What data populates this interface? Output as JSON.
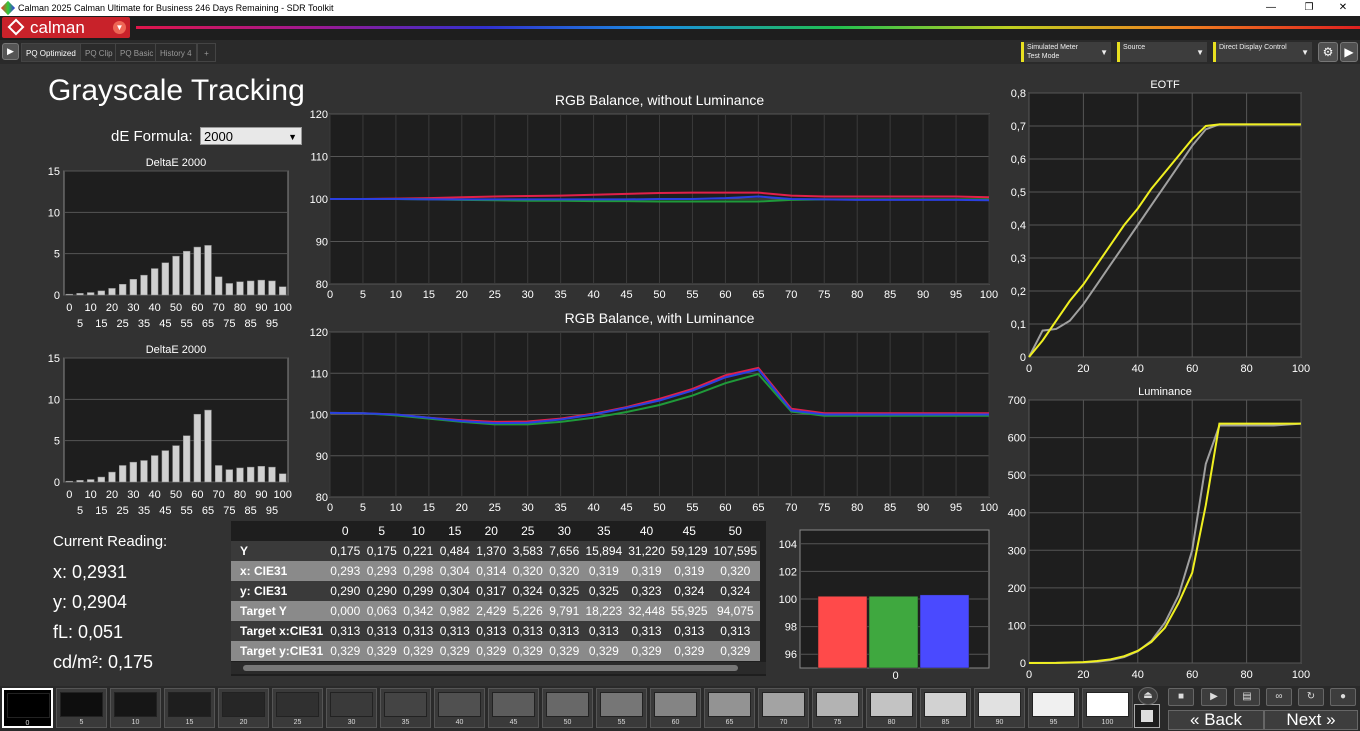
{
  "window": {
    "title": "Calman 2025 Calman Ultimate for Business 246 Days Remaining  - SDR Toolkit",
    "min": "—",
    "max": "❐",
    "close": "✕"
  },
  "brand": {
    "logo": "calman"
  },
  "tabs": [
    {
      "label": "PQ Optimized",
      "active": true
    },
    {
      "label": "PQ Clip"
    },
    {
      "label": "PQ Basic"
    },
    {
      "label": "History 4"
    },
    {
      "label": "+"
    }
  ],
  "controls": {
    "meter": {
      "line1": "Simulated Meter",
      "line2": "Test Mode"
    },
    "source": {
      "line1": "Source",
      "line2": ""
    },
    "display": {
      "line1": "Direct Display Control",
      "line2": ""
    }
  },
  "page": {
    "title": "Grayscale Tracking",
    "de_label": "dE Formula:",
    "de_value": "2000"
  },
  "colors": {
    "red": "#e0204a",
    "green": "#1f9a3a",
    "blue": "#2a3fe0",
    "yellow": "#f0f020",
    "gray_curve": "#a0a0a0"
  },
  "chart_data": [
    {
      "id": "de1",
      "type": "bar",
      "title": "DeltaE 2000",
      "ylim": [
        0,
        15
      ],
      "yticks": [
        0,
        5,
        10,
        15
      ],
      "x": [
        0,
        5,
        10,
        15,
        20,
        25,
        30,
        35,
        40,
        45,
        50,
        55,
        60,
        65,
        70,
        75,
        80,
        85,
        90,
        95,
        100
      ],
      "values": [
        0.1,
        0.2,
        0.3,
        0.5,
        0.8,
        1.3,
        1.9,
        2.4,
        3.2,
        3.9,
        4.7,
        5.3,
        5.8,
        6.0,
        2.2,
        1.4,
        1.6,
        1.7,
        1.8,
        1.7,
        1.0
      ],
      "xlabels_top": [
        "0",
        "10",
        "20",
        "30",
        "40",
        "50",
        "60",
        "70",
        "80",
        "90",
        "100"
      ],
      "xlabels_bottom": [
        "5",
        "15",
        "25",
        "35",
        "45",
        "55",
        "65",
        "75",
        "85",
        "95"
      ]
    },
    {
      "id": "de2",
      "type": "bar",
      "title": "DeltaE 2000",
      "ylim": [
        0,
        15
      ],
      "yticks": [
        0,
        5,
        10,
        15
      ],
      "x": [
        0,
        5,
        10,
        15,
        20,
        25,
        30,
        35,
        40,
        45,
        50,
        55,
        60,
        65,
        70,
        75,
        80,
        85,
        90,
        95,
        100
      ],
      "values": [
        0.1,
        0.2,
        0.3,
        0.6,
        1.2,
        2.0,
        2.4,
        2.6,
        3.2,
        3.8,
        4.4,
        5.6,
        8.2,
        8.7,
        2.0,
        1.5,
        1.7,
        1.8,
        1.9,
        1.8,
        1.0
      ],
      "xlabels_top": [
        "0",
        "10",
        "20",
        "30",
        "40",
        "50",
        "60",
        "70",
        "80",
        "90",
        "100"
      ],
      "xlabels_bottom": [
        "5",
        "15",
        "25",
        "35",
        "45",
        "55",
        "65",
        "75",
        "85",
        "95"
      ]
    },
    {
      "id": "rgb1",
      "type": "line",
      "title": "RGB Balance, without Luminance",
      "ylim": [
        80,
        120
      ],
      "yticks": [
        80,
        90,
        100,
        110,
        120
      ],
      "x": [
        0,
        5,
        10,
        15,
        20,
        25,
        30,
        35,
        40,
        45,
        50,
        55,
        60,
        65,
        70,
        75,
        80,
        85,
        90,
        95,
        100
      ],
      "series": [
        {
          "color": "red",
          "values": [
            100.0,
            100.0,
            100.1,
            100.2,
            100.4,
            100.6,
            100.7,
            100.8,
            101.0,
            101.2,
            101.4,
            101.5,
            101.5,
            101.5,
            100.8,
            100.6,
            100.6,
            100.6,
            100.6,
            100.6,
            100.4
          ]
        },
        {
          "color": "green",
          "values": [
            100.0,
            100.0,
            100.0,
            99.9,
            99.8,
            99.7,
            99.6,
            99.6,
            99.5,
            99.5,
            99.4,
            99.4,
            99.4,
            99.4,
            99.8,
            99.9,
            99.9,
            99.9,
            99.9,
            99.9,
            99.9
          ]
        },
        {
          "color": "blue",
          "values": [
            100.0,
            100.0,
            100.0,
            99.9,
            99.9,
            99.9,
            99.9,
            99.9,
            99.9,
            99.9,
            100.0,
            100.0,
            100.2,
            100.6,
            100.0,
            99.9,
            99.8,
            99.8,
            99.8,
            99.8,
            99.7
          ]
        }
      ]
    },
    {
      "id": "rgb2",
      "type": "line",
      "title": "RGB Balance, with Luminance",
      "ylim": [
        80,
        120
      ],
      "yticks": [
        80,
        90,
        100,
        110,
        120
      ],
      "x": [
        0,
        5,
        10,
        15,
        20,
        25,
        30,
        35,
        40,
        45,
        50,
        55,
        60,
        65,
        70,
        75,
        80,
        85,
        90,
        95,
        100
      ],
      "series": [
        {
          "color": "red",
          "values": [
            100.4,
            100.3,
            100.0,
            99.2,
            98.6,
            98.2,
            98.3,
            99.0,
            100.2,
            101.8,
            103.8,
            106.2,
            109.5,
            111.3,
            101.4,
            100.3,
            100.3,
            100.3,
            100.3,
            100.3,
            100.3
          ]
        },
        {
          "color": "green",
          "values": [
            100.4,
            100.3,
            99.8,
            99.0,
            98.2,
            97.6,
            97.6,
            98.2,
            99.2,
            100.6,
            102.3,
            104.6,
            107.6,
            109.8,
            100.7,
            99.7,
            99.7,
            99.7,
            99.7,
            99.7,
            99.7
          ]
        },
        {
          "color": "blue",
          "values": [
            100.4,
            100.3,
            100.0,
            99.2,
            98.4,
            97.9,
            98.0,
            98.8,
            100.0,
            101.6,
            103.4,
            105.8,
            109.0,
            110.9,
            101.0,
            100.0,
            100.0,
            100.0,
            100.0,
            100.0,
            100.0
          ]
        }
      ]
    },
    {
      "id": "eotf",
      "type": "line",
      "title": "EOTF",
      "xlim": [
        0,
        100
      ],
      "ylim": [
        0,
        0.8
      ],
      "xticks": [
        0,
        20,
        40,
        60,
        80,
        100
      ],
      "ylabels": [
        "0",
        "0,1",
        "0,2",
        "0,3",
        "0,4",
        "0,5",
        "0,6",
        "0,7",
        "0,8"
      ],
      "series": [
        {
          "color": "gray",
          "x": [
            0,
            5,
            10,
            15,
            20,
            25,
            30,
            35,
            40,
            45,
            50,
            55,
            60,
            65,
            70,
            80,
            90,
            100
          ],
          "values": [
            0.0,
            0.08,
            0.085,
            0.11,
            0.16,
            0.22,
            0.28,
            0.34,
            0.4,
            0.46,
            0.52,
            0.58,
            0.64,
            0.69,
            0.705,
            0.705,
            0.705,
            0.705
          ]
        },
        {
          "color": "yellow",
          "x": [
            0,
            5,
            10,
            15,
            20,
            25,
            30,
            35,
            40,
            45,
            50,
            55,
            60,
            65,
            70,
            80,
            90,
            100
          ],
          "values": [
            0.0,
            0.05,
            0.11,
            0.17,
            0.22,
            0.28,
            0.34,
            0.4,
            0.45,
            0.51,
            0.56,
            0.61,
            0.66,
            0.7,
            0.705,
            0.705,
            0.705,
            0.705
          ]
        }
      ]
    },
    {
      "id": "lum",
      "type": "line",
      "title": "Luminance",
      "xlim": [
        0,
        100
      ],
      "ylim": [
        0,
        700
      ],
      "xticks": [
        0,
        20,
        40,
        60,
        80,
        100
      ],
      "yticks": [
        0,
        100,
        200,
        300,
        400,
        500,
        600,
        700
      ],
      "series": [
        {
          "color": "gray",
          "x": [
            0,
            10,
            20,
            25,
            30,
            35,
            40,
            45,
            50,
            55,
            60,
            65,
            70,
            80,
            90,
            100
          ],
          "values": [
            0.2,
            0.2,
            1.4,
            3.6,
            7.7,
            15.9,
            31.2,
            59.1,
            107.6,
            180,
            300,
            530,
            632,
            632,
            632,
            637
          ]
        },
        {
          "color": "yellow",
          "x": [
            0,
            10,
            20,
            25,
            30,
            35,
            40,
            45,
            50,
            55,
            60,
            65,
            70,
            80,
            90,
            100
          ],
          "values": [
            0.0,
            0.3,
            2.4,
            5.2,
            9.8,
            18.2,
            32.4,
            55.9,
            94.1,
            160,
            240,
            420,
            637,
            637,
            637,
            637
          ]
        }
      ]
    },
    {
      "id": "rgbbar",
      "type": "bar",
      "xlabel": "0",
      "ylim": [
        95,
        105
      ],
      "yticks": [
        96,
        98,
        100,
        102,
        104
      ],
      "categories": [
        "R",
        "G",
        "B"
      ],
      "values": [
        100.2,
        100.2,
        100.3
      ],
      "colors": [
        "#ff4a4a",
        "#3fa83f",
        "#4a4aff"
      ]
    }
  ],
  "reading": {
    "title": "Current Reading:",
    "x": "x: 0,2931",
    "y": "y: 0,2904",
    "fl": "fL: 0,051",
    "cd": "cd/m²: 0,175"
  },
  "table": {
    "columns": [
      "",
      "0",
      "5",
      "10",
      "15",
      "20",
      "25",
      "30",
      "35",
      "40",
      "45",
      "50"
    ],
    "rows": [
      {
        "label": "Y",
        "values": [
          "0,175",
          "0,175",
          "0,221",
          "0,484",
          "1,370",
          "3,583",
          "7,656",
          "15,894",
          "31,220",
          "59,129",
          "107,595"
        ]
      },
      {
        "label": "x: CIE31",
        "values": [
          "0,293",
          "0,293",
          "0,298",
          "0,304",
          "0,314",
          "0,320",
          "0,320",
          "0,319",
          "0,319",
          "0,319",
          "0,320"
        ]
      },
      {
        "label": "y: CIE31",
        "values": [
          "0,290",
          "0,290",
          "0,299",
          "0,304",
          "0,317",
          "0,324",
          "0,325",
          "0,325",
          "0,323",
          "0,324",
          "0,324"
        ]
      },
      {
        "label": "Target Y",
        "values": [
          "0,000",
          "0,063",
          "0,342",
          "0,982",
          "2,429",
          "5,226",
          "9,791",
          "18,223",
          "32,448",
          "55,925",
          "94,075"
        ]
      },
      {
        "label": "Target x:CIE31",
        "values": [
          "0,313",
          "0,313",
          "0,313",
          "0,313",
          "0,313",
          "0,313",
          "0,313",
          "0,313",
          "0,313",
          "0,313",
          "0,313"
        ]
      },
      {
        "label": "Target y:CIE31",
        "values": [
          "0,329",
          "0,329",
          "0,329",
          "0,329",
          "0,329",
          "0,329",
          "0,329",
          "0,329",
          "0,329",
          "0,329",
          "0,329"
        ]
      }
    ]
  },
  "patches": [
    {
      "label": "0",
      "color": "#000000",
      "selected": true
    },
    {
      "label": "5",
      "color": "#0e0e0e"
    },
    {
      "label": "10",
      "color": "#161616"
    },
    {
      "label": "15",
      "color": "#1e1e1e"
    },
    {
      "label": "20",
      "color": "#262626"
    },
    {
      "label": "25",
      "color": "#303030"
    },
    {
      "label": "30",
      "color": "#3a3a3a"
    },
    {
      "label": "35",
      "color": "#444444"
    },
    {
      "label": "40",
      "color": "#505050"
    },
    {
      "label": "45",
      "color": "#5c5c5c"
    },
    {
      "label": "50",
      "color": "#686868"
    },
    {
      "label": "55",
      "color": "#767676"
    },
    {
      "label": "60",
      "color": "#848484"
    },
    {
      "label": "65",
      "color": "#939393"
    },
    {
      "label": "70",
      "color": "#a3a3a3"
    },
    {
      "label": "75",
      "color": "#b3b3b3"
    },
    {
      "label": "80",
      "color": "#c3c3c3"
    },
    {
      "label": "85",
      "color": "#d2d2d2"
    },
    {
      "label": "90",
      "color": "#e1e1e1"
    },
    {
      "label": "95",
      "color": "#f0f0f0"
    },
    {
      "label": "100",
      "color": "#ffffff"
    }
  ],
  "nav": {
    "back": "Back",
    "next": "Next"
  }
}
